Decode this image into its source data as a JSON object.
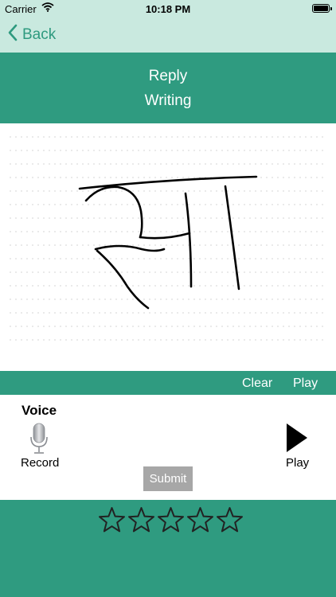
{
  "status_bar": {
    "carrier": "Carrier",
    "time": "10:18 PM"
  },
  "nav": {
    "back_label": "Back"
  },
  "header": {
    "title_line1": "Reply",
    "title_line2": "Writing"
  },
  "toolbar": {
    "clear_label": "Clear",
    "play_label": "Play"
  },
  "voice": {
    "title": "Voice",
    "record_label": "Record",
    "play_label": "Play"
  },
  "submit_label": "Submit",
  "rating": {
    "stars_total": 5,
    "stars_filled": 0
  },
  "colors": {
    "nav_bg": "#c9e9df",
    "accent": "#2f9b80",
    "back_text": "#2e9a7f",
    "submit_bg": "#a7a7a7"
  }
}
